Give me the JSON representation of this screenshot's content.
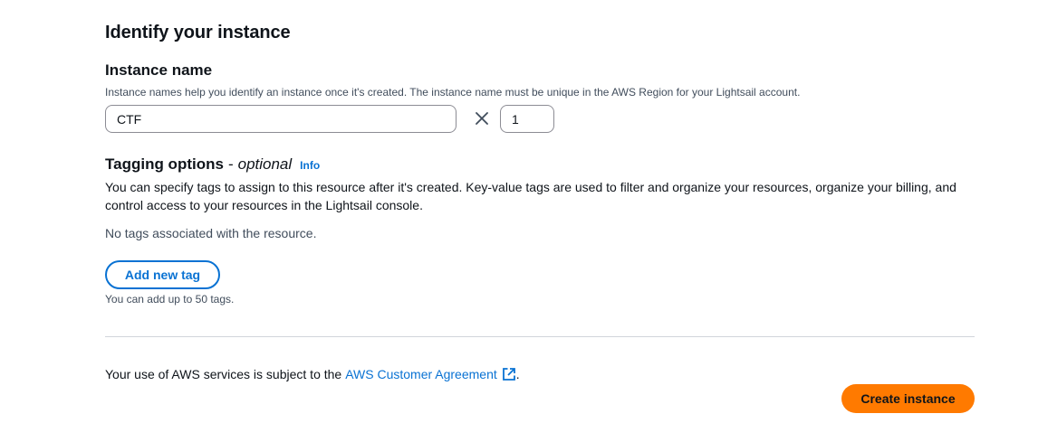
{
  "section": {
    "title": "Identify your instance"
  },
  "instance_name": {
    "label": "Instance name",
    "description": "Instance names help you identify an instance once it's created. The instance name must be unique in the AWS Region for your Lightsail account.",
    "value": "CTF",
    "count_value": "1",
    "multiply_icon": "close-icon"
  },
  "tagging": {
    "title": "Tagging options",
    "separator": "-",
    "optional": "optional",
    "info": "Info",
    "description": "You can specify tags to assign to this resource after it's created. Key-value tags are used to filter and organize your resources, organize your billing, and control access to your resources in the Lightsail console.",
    "empty": "No tags associated with the resource.",
    "add_button": "Add new tag",
    "limit": "You can add up to 50 tags."
  },
  "footer": {
    "agreement_prefix": "Your use of AWS services is subject to the",
    "agreement_link": "AWS Customer Agreement",
    "agreement_suffix": ".",
    "external_icon": "external-link-icon",
    "create_button": "Create instance"
  },
  "colors": {
    "link": "#0972d3",
    "primary_button": "#ff7a00",
    "text": "#0f141a",
    "muted_text": "#414d5c"
  }
}
